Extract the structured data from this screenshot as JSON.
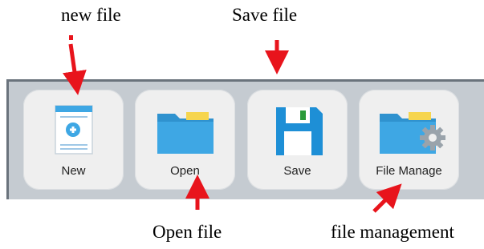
{
  "annotations": {
    "new_file": "new file",
    "save_file": "Save file",
    "open_file": "Open file",
    "file_management": "file management"
  },
  "toolbar": {
    "buttons": [
      {
        "label": "New",
        "icon": "new-file-icon"
      },
      {
        "label": "Open",
        "icon": "folder-icon"
      },
      {
        "label": "Save",
        "icon": "floppy-disk-icon"
      },
      {
        "label": "File Manage",
        "icon": "folder-gear-icon"
      }
    ]
  },
  "colors": {
    "arrow": "#e8141c",
    "folder_blue": "#3ea7e4",
    "folder_tab": "#f6d54e",
    "toolbar_bg": "#c5cbd1",
    "button_bg": "#efefef"
  }
}
